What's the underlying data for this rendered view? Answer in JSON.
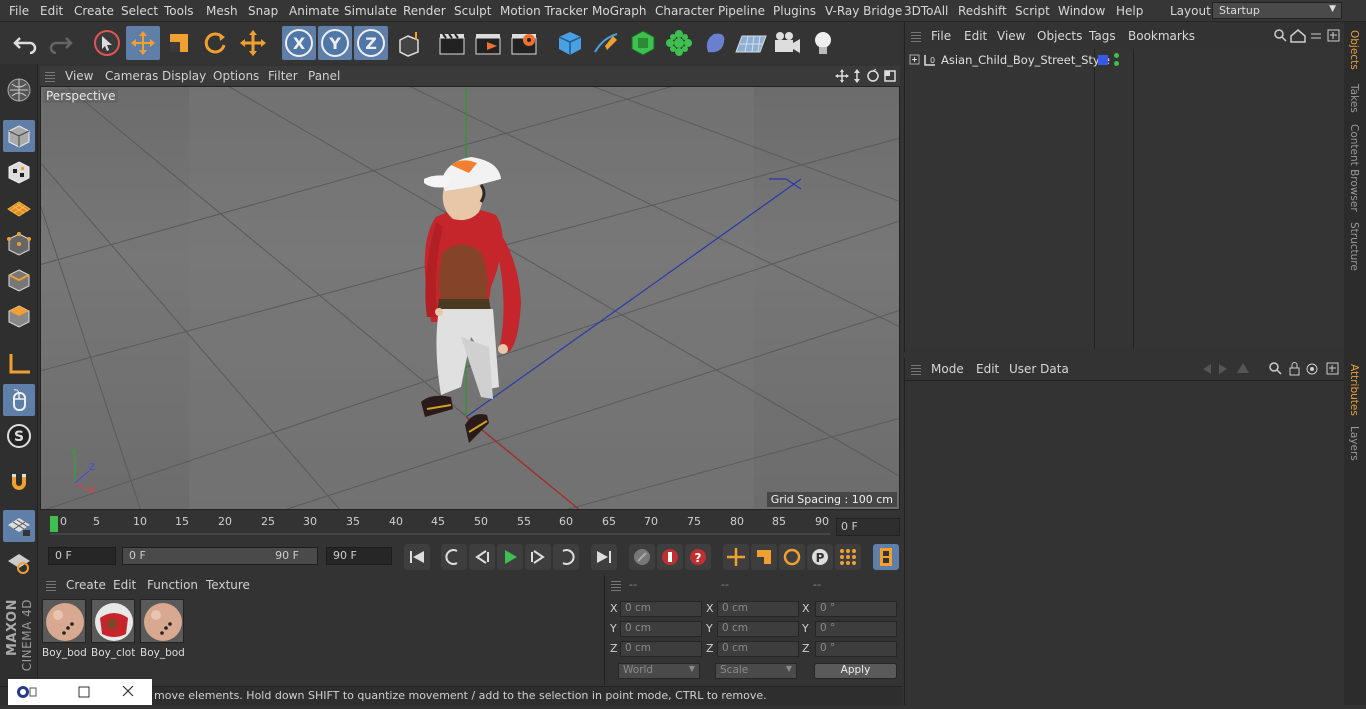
{
  "menubar": {
    "items": [
      "File",
      "Edit",
      "Create",
      "Select",
      "Tools",
      "Mesh",
      "Snap",
      "Animate",
      "Simulate",
      "Render",
      "Sculpt",
      "Motion Tracker",
      "MoGraph",
      "Character",
      "Pipeline",
      "Plugins",
      "V-Ray Bridge",
      "3DToAll",
      "Redshift",
      "Script",
      "Window",
      "Help"
    ],
    "layout_label": "Layout:",
    "layout_value": "Startup"
  },
  "toolbar": {
    "axes": [
      "X",
      "Y",
      "Z"
    ]
  },
  "viewport": {
    "menu": [
      "View",
      "Cameras",
      "Display",
      "Options",
      "Filter",
      "Panel"
    ],
    "label": "Perspective",
    "grid_spacing": "Grid Spacing : 100 cm"
  },
  "timeline": {
    "ticks": [
      "0",
      "5",
      "10",
      "15",
      "20",
      "25",
      "30",
      "35",
      "40",
      "45",
      "50",
      "55",
      "60",
      "65",
      "70",
      "75",
      "80",
      "85",
      "90"
    ],
    "current_frame": "0 F"
  },
  "playbar": {
    "start": "0 F",
    "range_start": "0 F",
    "range_end": "90 F",
    "end": "90 F"
  },
  "materials": {
    "menu": [
      "Create",
      "Edit",
      "Function",
      "Texture"
    ],
    "items": [
      {
        "name": "Boy_bod"
      },
      {
        "name": "Boy_clot"
      },
      {
        "name": "Boy_bod"
      }
    ]
  },
  "coords": {
    "headers": [
      "--",
      "--",
      "--"
    ],
    "rows": [
      {
        "axis": "X",
        "pos": "0 cm",
        "size_axis": "X",
        "size": "0 cm",
        "rot_axis": "X",
        "rot": "0 °"
      },
      {
        "axis": "Y",
        "pos": "0 cm",
        "size_axis": "Y",
        "size": "0 cm",
        "rot_axis": "Y",
        "rot": "0 °"
      },
      {
        "axis": "Z",
        "pos": "0 cm",
        "size_axis": "Z",
        "size": "0 cm",
        "rot_axis": "Z",
        "rot": "0 °"
      }
    ],
    "mode_world": "World",
    "mode_scale": "Scale",
    "apply": "Apply"
  },
  "status": {
    "text": "move elements. Hold down SHIFT to quantize movement / add to the selection in point mode, CTRL to remove."
  },
  "objects": {
    "menu": [
      "File",
      "Edit",
      "View",
      "Objects",
      "Tags",
      "Bookmarks"
    ],
    "items": [
      {
        "name": "Asian_Child_Boy_Street_Style"
      }
    ]
  },
  "attributes": {
    "menu": [
      "Mode",
      "Edit",
      "User Data"
    ]
  },
  "side_tabs": [
    "Objects",
    "Takes",
    "Content Browser",
    "Structure",
    "Attributes",
    "Layers"
  ],
  "brand": {
    "maxon": "MAXON",
    "product": "CINEMA 4D"
  }
}
